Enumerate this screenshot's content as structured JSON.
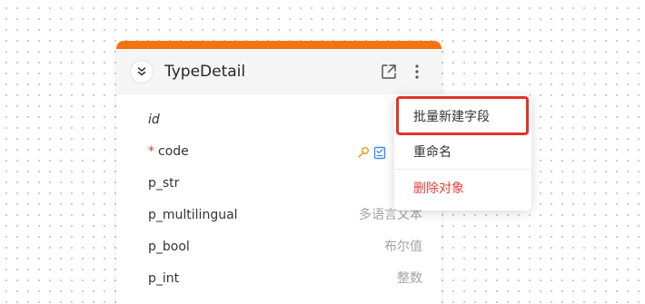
{
  "entity_card": {
    "title": "TypeDetail",
    "accent_color": "#f5730f",
    "icons": {
      "collapse": "double-chevron-down-icon",
      "open": "open-external-icon",
      "more": "more-vertical-icon"
    },
    "fields": [
      {
        "name": "id",
        "type": "",
        "italic": true,
        "required": false
      },
      {
        "name": "code",
        "type": "",
        "italic": false,
        "required": true,
        "required_mark": "*",
        "icons": [
          "key-icon",
          "checkbox-list-icon"
        ]
      },
      {
        "name": "p_str",
        "type": "",
        "italic": false,
        "required": false
      },
      {
        "name": "p_multilingual",
        "type": "多语言文本",
        "italic": false,
        "required": false
      },
      {
        "name": "p_bool",
        "type": "布尔值",
        "italic": false,
        "required": false
      },
      {
        "name": "p_int",
        "type": "整数",
        "italic": false,
        "required": false
      }
    ]
  },
  "context_menu": {
    "items": [
      {
        "label": "批量新建字段",
        "color": "#333333",
        "highlighted": true
      },
      {
        "label": "重命名",
        "color": "#333333",
        "highlighted": false
      },
      {
        "label": "删除对象",
        "color": "#e5403c",
        "highlighted": false
      }
    ],
    "highlight_color": "#e53226"
  }
}
